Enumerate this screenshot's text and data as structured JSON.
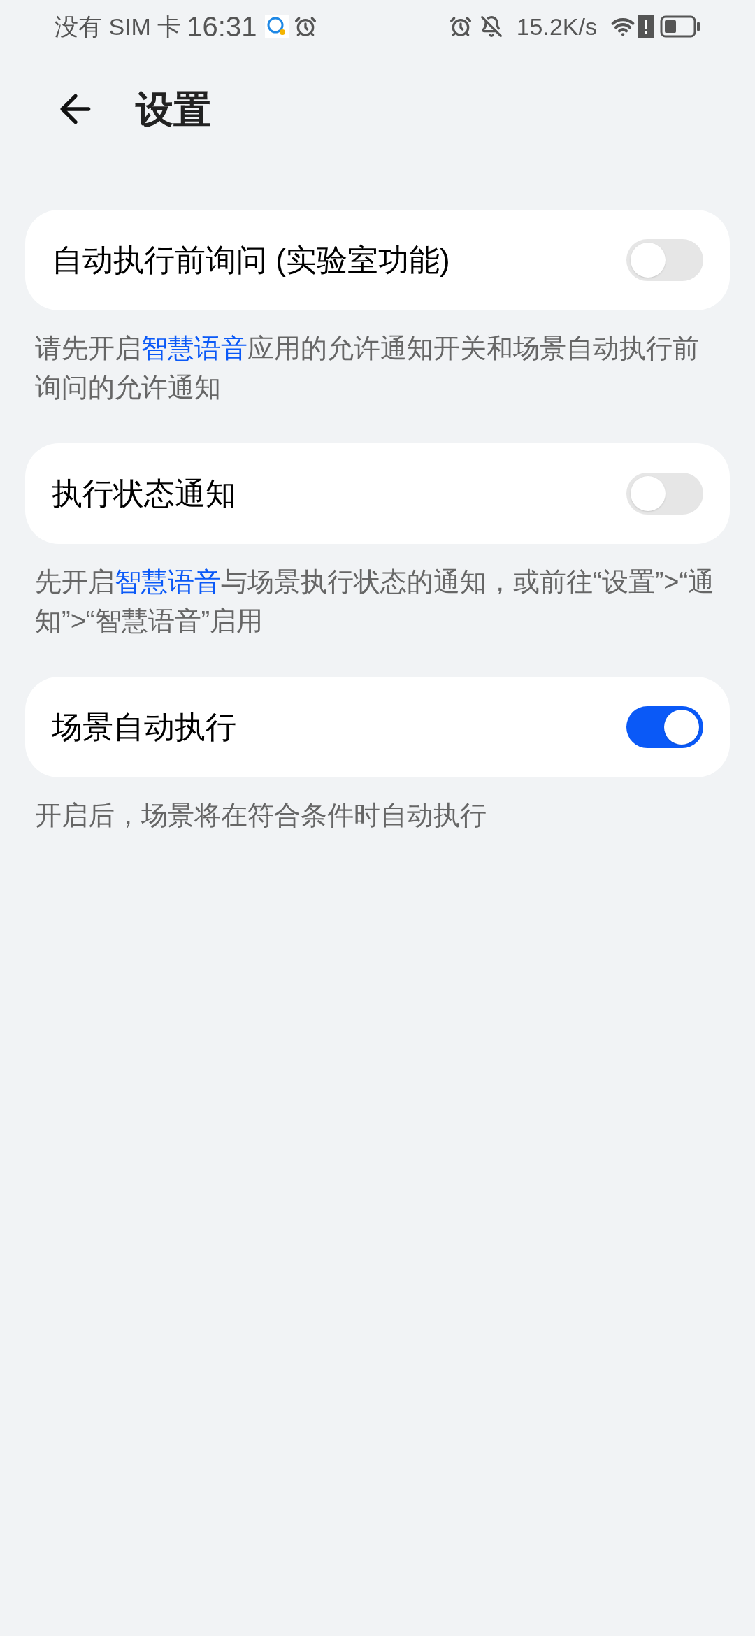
{
  "status_bar": {
    "carrier": "没有 SIM 卡",
    "time": "16:31",
    "speed": "15.2K/s"
  },
  "header": {
    "title": "设置"
  },
  "settings": [
    {
      "label": "自动执行前询问 (实验室功能)",
      "on": false,
      "note": {
        "before": "请先开启",
        "link": "智慧语音",
        "after": "应用的允许通知开关和场景自动执行前询问的允许通知"
      }
    },
    {
      "label": "执行状态通知",
      "on": false,
      "note": {
        "before": "先开启",
        "link": "智慧语音",
        "after": "与场景执行状态的通知，或前往“设置”>“通知”>“智慧语音”启用"
      }
    },
    {
      "label": "场景自动执行",
      "on": true,
      "note": {
        "before": "开启后，场景将在符合条件时自动执行"
      }
    }
  ]
}
